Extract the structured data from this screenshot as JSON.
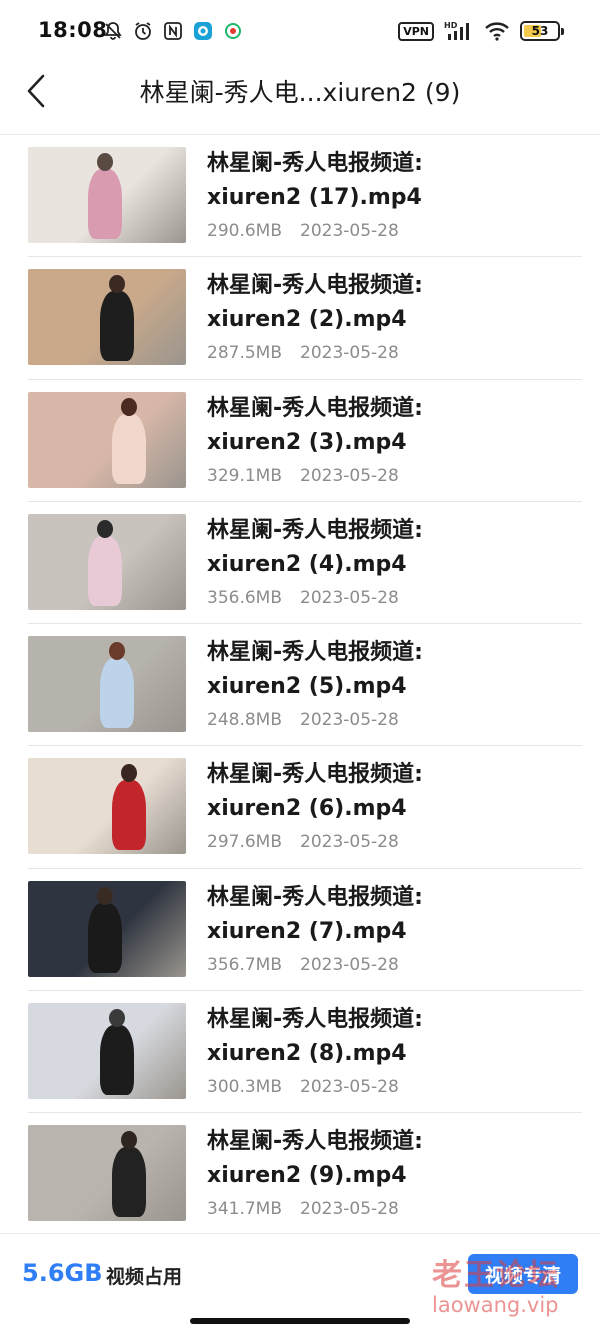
{
  "status_bar": {
    "time": "18:08",
    "vpn": "VPN",
    "network": "HD",
    "battery": "53",
    "battery_level": 0.53,
    "icons_left": [
      "mute-bell-icon",
      "alarm-icon",
      "nfc-icon",
      "app-icon",
      "app-icon-2"
    ],
    "icons_right": [
      "vpn-icon",
      "signal-icon",
      "wifi-icon",
      "battery-icon"
    ]
  },
  "header": {
    "title": "林星阑-秀人电...xiuren2 (9)",
    "back_icon": "chevron-left-icon"
  },
  "files": [
    {
      "line1": "林星阑-秀人电报频道:",
      "line2": "xiuren2 (17).mp4",
      "size": "290.6MB",
      "date": "2023-05-28"
    },
    {
      "line1": "林星阑-秀人电报频道:",
      "line2": "xiuren2 (2).mp4",
      "size": "287.5MB",
      "date": "2023-05-28"
    },
    {
      "line1": "林星阑-秀人电报频道:",
      "line2": "xiuren2 (3).mp4",
      "size": "329.1MB",
      "date": "2023-05-28"
    },
    {
      "line1": "林星阑-秀人电报频道:",
      "line2": "xiuren2 (4).mp4",
      "size": "356.6MB",
      "date": "2023-05-28"
    },
    {
      "line1": "林星阑-秀人电报频道:",
      "line2": "xiuren2 (5).mp4",
      "size": "248.8MB",
      "date": "2023-05-28"
    },
    {
      "line1": "林星阑-秀人电报频道:",
      "line2": "xiuren2 (6).mp4",
      "size": "297.6MB",
      "date": "2023-05-28"
    },
    {
      "line1": "林星阑-秀人电报频道:",
      "line2": "xiuren2 (7).mp4",
      "size": "356.7MB",
      "date": "2023-05-28"
    },
    {
      "line1": "林星阑-秀人电报频道:",
      "line2": "xiuren2 (8).mp4",
      "size": "300.3MB",
      "date": "2023-05-28"
    },
    {
      "line1": "林星阑-秀人电报频道:",
      "line2": "xiuren2 (9).mp4",
      "size": "341.7MB",
      "date": "2023-05-28"
    }
  ],
  "bottom_bar": {
    "storage_size": "5.6GB",
    "storage_label": "视频占用",
    "cleanup_label": "视频专清"
  },
  "watermark": {
    "text": "老王论坛",
    "url": "laowang.vip"
  },
  "colors": {
    "accent": "#2f7ef5",
    "meta_text": "#8c8c8c",
    "watermark": "#dc3c3c"
  }
}
